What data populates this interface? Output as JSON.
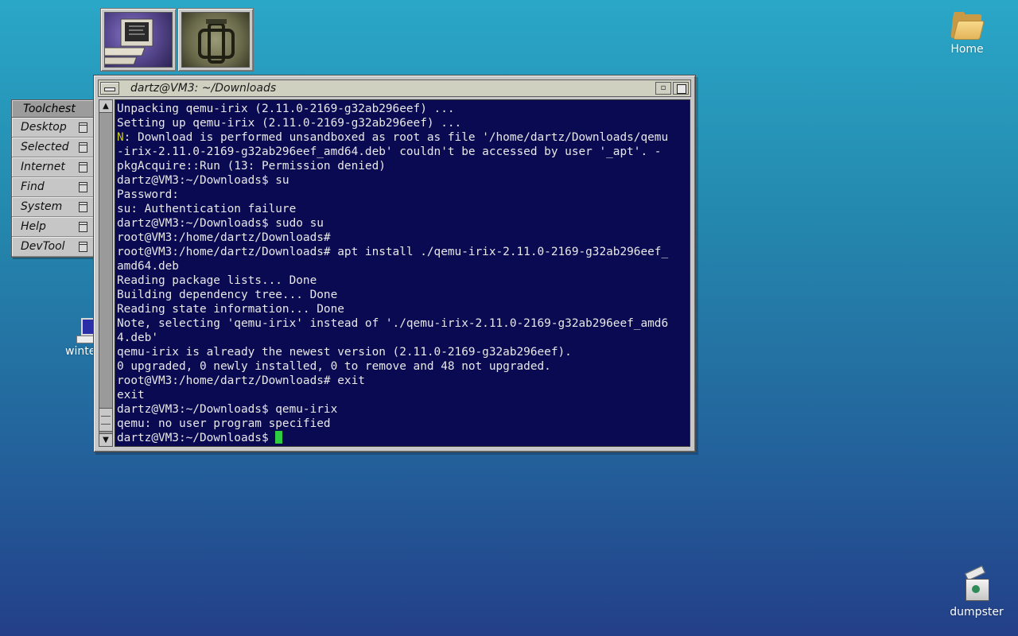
{
  "toolchest": {
    "title": "Toolchest",
    "items": [
      {
        "label": "Desktop"
      },
      {
        "label": "Selected"
      },
      {
        "label": "Internet"
      },
      {
        "label": "Find"
      },
      {
        "label": "System"
      },
      {
        "label": "Help"
      },
      {
        "label": "DevTool"
      }
    ]
  },
  "launchers": [
    {
      "icon": "console-computer-icon"
    },
    {
      "icon": "sgi-logo-icon"
    }
  ],
  "desktop_icons": {
    "home": {
      "label": "Home",
      "icon": "folder-icon"
    },
    "dumpster": {
      "label": "dumpster",
      "icon": "dumpster-icon"
    },
    "winterm": {
      "label": "winterm",
      "icon": "terminal-icon"
    }
  },
  "terminal": {
    "title": "dartz@VM3: ~/Downloads",
    "lines": [
      "Unpacking qemu-irix (2.11.0-2169-g32ab296eef) ...",
      "Setting up qemu-irix (2.11.0-2169-g32ab296eef) ...",
      ": Download is performed unsandboxed as root as file '/home/dartz/Downloads/qemu",
      "-irix-2.11.0-2169-g32ab296eef_amd64.deb' couldn't be accessed by user '_apt'. -",
      "pkgAcquire::Run (13: Permission denied)",
      "dartz@VM3:~/Downloads$ su",
      "Password:",
      "su: Authentication failure",
      "dartz@VM3:~/Downloads$ sudo su",
      "root@VM3:/home/dartz/Downloads#",
      "root@VM3:/home/dartz/Downloads# apt install ./qemu-irix-2.11.0-2169-g32ab296eef_",
      "amd64.deb",
      "Reading package lists... Done",
      "Building dependency tree... Done",
      "Reading state information... Done",
      "Note, selecting 'qemu-irix' instead of './qemu-irix-2.11.0-2169-g32ab296eef_amd6",
      "4.deb'",
      "qemu-irix is already the newest version (2.11.0-2169-g32ab296eef).",
      "0 upgraded, 0 newly installed, 0 to remove and 48 not upgraded.",
      "root@VM3:/home/dartz/Downloads# exit",
      "exit",
      "dartz@VM3:~/Downloads$ qemu-irix",
      "qemu: no user program specified",
      "dartz@VM3:~/Downloads$ "
    ],
    "notice_tag": "N",
    "colors": {
      "background": "#0a0a52",
      "text": "#e8e8e8",
      "notice": "#c8c820",
      "cursor": "#2ecc40"
    }
  }
}
